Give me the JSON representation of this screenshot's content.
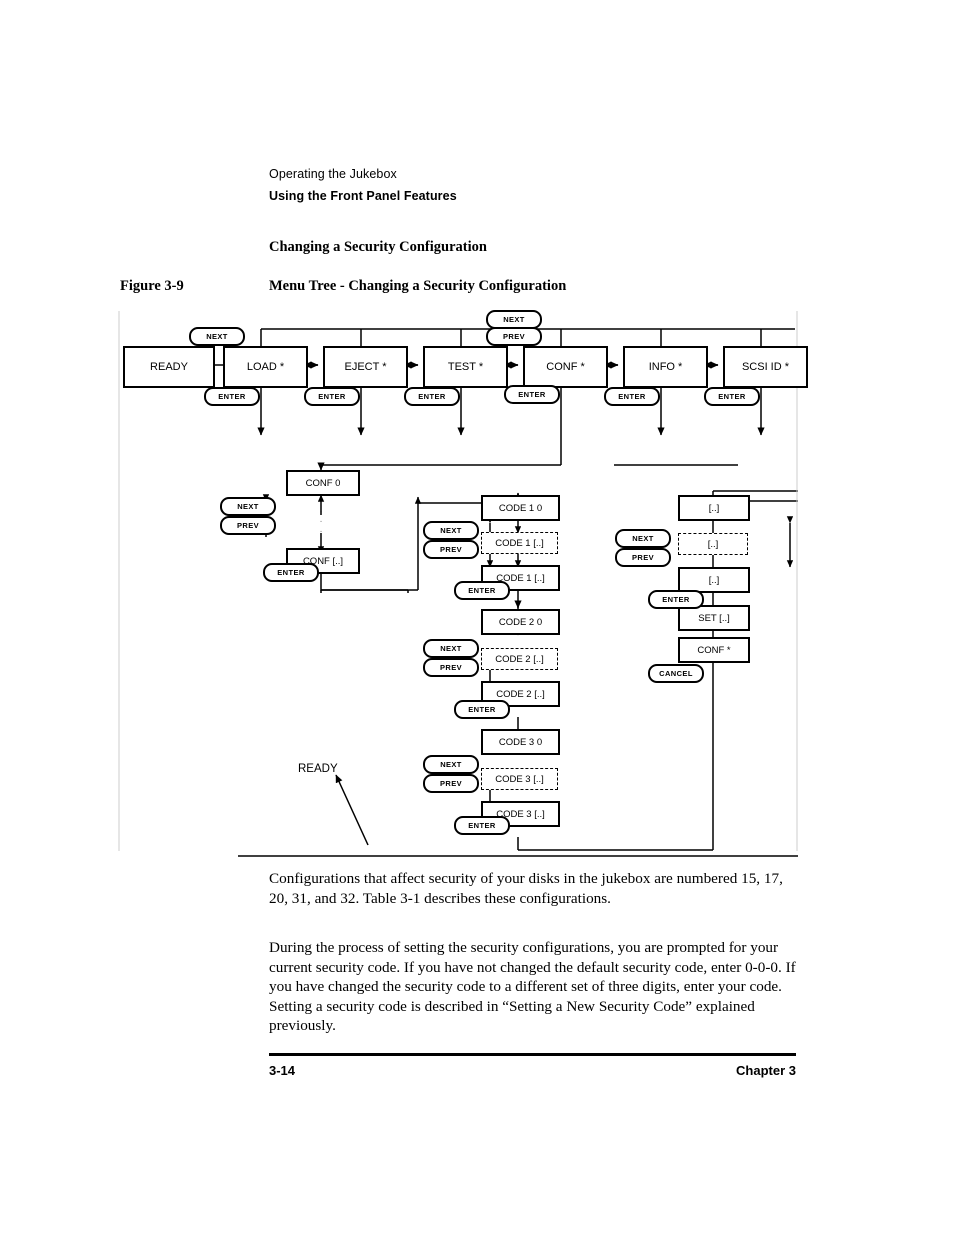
{
  "runhead": {
    "line1": "Operating the Jukebox",
    "line2": "Using the Front Panel Features"
  },
  "section_heading": "Changing a Security Configuration",
  "figure": {
    "number": "Figure 3-9",
    "title": "Menu Tree - Changing a Security Configuration"
  },
  "diagram": {
    "top_row": [
      {
        "label": "READY"
      },
      {
        "label": "LOAD *"
      },
      {
        "label": "EJECT *"
      },
      {
        "label": "TEST *"
      },
      {
        "label": "CONF *"
      },
      {
        "label": "INFO *"
      },
      {
        "label": "SCSI ID *"
      }
    ],
    "top_row_enter_labels": [
      "ENTER",
      "ENTER",
      "ENTER",
      "ENTER",
      "ENTER",
      "ENTER"
    ],
    "top_next_label": "NEXT",
    "top_nextprev": {
      "next": "NEXT",
      "prev": "PREV"
    },
    "conf_column": {
      "box_first": "CONF 0",
      "box_last": "CONF [..]",
      "next": "NEXT",
      "prev": "PREV",
      "enter": "ENTER",
      "ellipsis": "◦"
    },
    "code_groups": [
      {
        "box_first": "CODE 1  0",
        "box_dashed": "CODE 1   [..]",
        "box_last": "CODE 1  [..]",
        "next": "NEXT",
        "prev": "PREV",
        "enter": "ENTER"
      },
      {
        "box_first": "CODE 2  0",
        "box_dashed": "CODE 2   [..]",
        "box_last": "CODE 2  [..]",
        "next": "NEXT",
        "prev": "PREV",
        "enter": "ENTER"
      },
      {
        "box_first": "CODE 3  0",
        "box_dashed": "CODE 3   [..]",
        "box_last": "CODE 3  [..]",
        "next": "NEXT",
        "prev": "PREV",
        "enter": "ENTER"
      }
    ],
    "value_column": {
      "box_first": "[..]",
      "box_dashed": "[..]",
      "box_last": "[..]",
      "box_set": "SET [..]",
      "box_conf": "CONF *",
      "next": "NEXT",
      "prev": "PREV",
      "enter": "ENTER",
      "cancel": "CANCEL"
    },
    "ready_return_label": "READY"
  },
  "body": {
    "paragraph_1": "Configurations that affect security of your disks in the jukebox are numbered 15, 17, 20, 31, and 32. Table 3-1 describes these configurations.",
    "paragraph_2": "During the process of setting the security configurations, you are prompted for your current security code. If you have not changed the default security code, enter 0-0-0. If you have changed the security code to a different set of three digits, enter your code. Setting a security code is described in “Setting a New Security Code” explained previously."
  },
  "footer": {
    "page": "3-14",
    "chapter": "Chapter 3"
  }
}
